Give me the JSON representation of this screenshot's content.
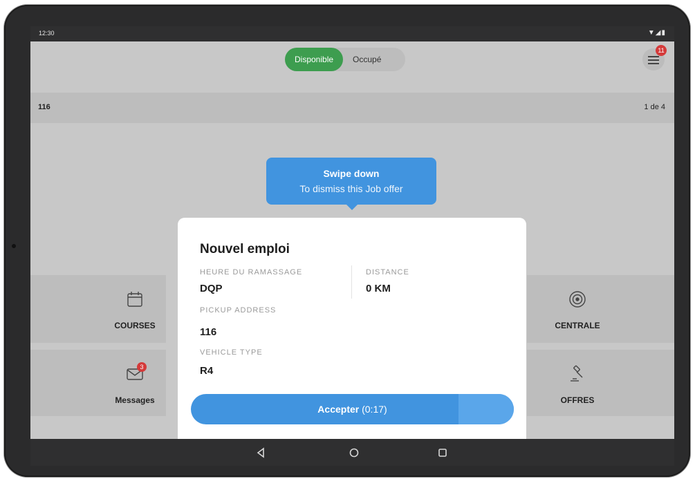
{
  "status_bar": {
    "time": "12:30",
    "system_icons": "▼◢▮"
  },
  "header": {
    "toggle": {
      "available_label": "Disponible",
      "busy_label": "Occupé",
      "selected": "Disponible"
    },
    "menu_badge_count": "11"
  },
  "info_strip": {
    "left_text": "116",
    "right_text": "1 de 4"
  },
  "tooltip": {
    "line1": "Swipe down",
    "line2": "To dismiss this Job offer"
  },
  "tiles": {
    "courses_label": "COURSES",
    "messages_label": "Messages",
    "messages_badge": "3",
    "centrale_label": "CENTRALE",
    "offres_label": "OFFRES"
  },
  "job_offer": {
    "title": "Nouvel emploi",
    "pickup_time_label": "HEURE DU RAMASSAGE",
    "pickup_time_value": "DQP",
    "distance_label": "DISTANCE",
    "distance_value": "0 KM",
    "pickup_address_label": "PICKUP ADDRESS",
    "pickup_address_value": "116",
    "vehicle_type_label": "VEHICLE TYPE",
    "vehicle_type_value": "R4",
    "accept_label": "Accepter",
    "accept_timer": "(0:17)"
  },
  "colors": {
    "primary_blue": "#4194df",
    "available_green": "#3d9d4f",
    "badge_red": "#d43a3a"
  }
}
